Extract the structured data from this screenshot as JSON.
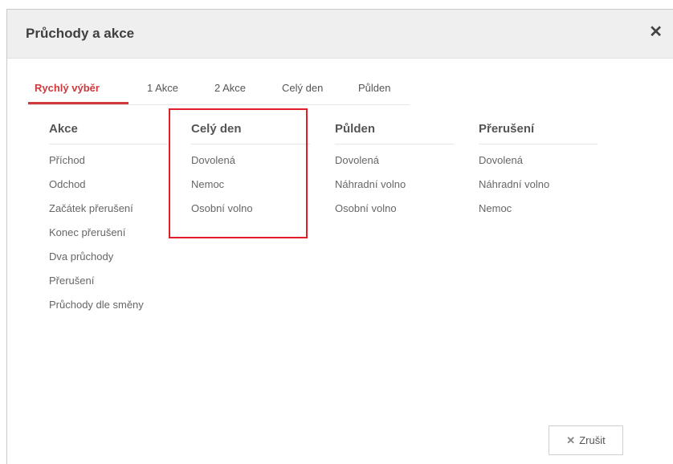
{
  "dialog": {
    "title": "Průchody a akce",
    "close_icon": "close-icon",
    "tabs": [
      {
        "label": "Rychlý výběr",
        "active": true
      },
      {
        "label": "1 Akce"
      },
      {
        "label": "2 Akce"
      },
      {
        "label": "Celý den"
      },
      {
        "label": "Půlden"
      }
    ],
    "columns": [
      {
        "title": "Akce",
        "items": [
          "Příchod",
          "Odchod",
          "Začátek přerušení",
          "Konec přerušení",
          "Dva průchody",
          "Přerušení",
          "Průchody dle směny"
        ]
      },
      {
        "title": "Celý den",
        "items": [
          "Dovolená",
          "Nemoc",
          "Osobní volno"
        ]
      },
      {
        "title": "Půlden",
        "items": [
          "Dovolená",
          "Náhradní volno",
          "Osobní volno"
        ]
      },
      {
        "title": "Přerušení",
        "items": [
          "Dovolená",
          "Náhradní volno",
          "Nemoc"
        ]
      }
    ],
    "cancel_label": "Zrušit",
    "accent_color": "#d0393b",
    "highlight_color": "#e11d2a"
  }
}
